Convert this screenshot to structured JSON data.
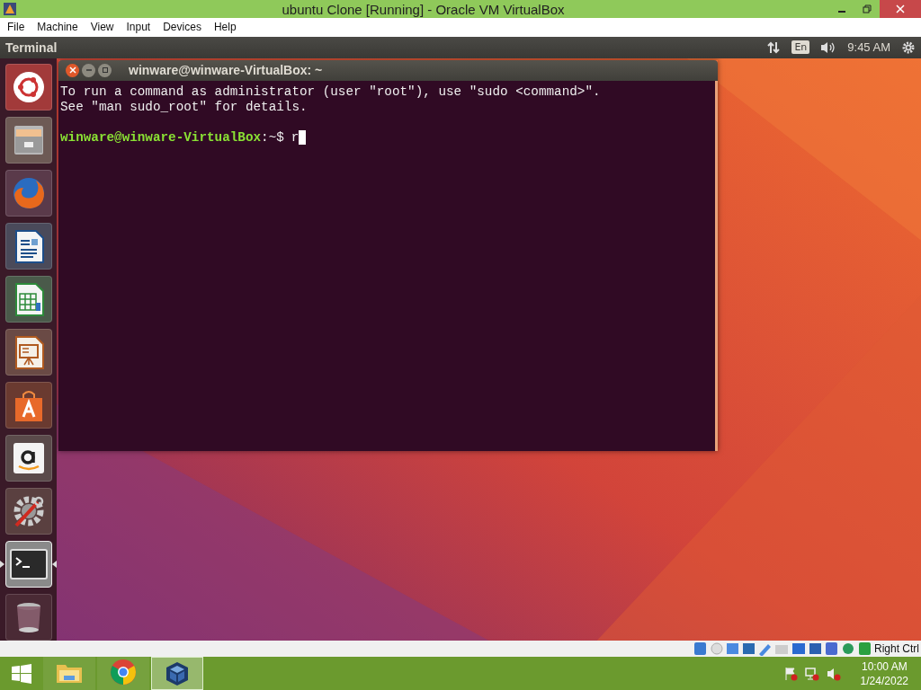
{
  "window": {
    "title": "ubuntu Clone [Running] - Oracle VM VirtualBox"
  },
  "menu": [
    "File",
    "Machine",
    "View",
    "Input",
    "Devices",
    "Help"
  ],
  "ubuntu_panel": {
    "app_title": "Terminal",
    "keyboard": "En",
    "clock": "9:45 AM"
  },
  "launcher": [
    {
      "kind": "ubuntu",
      "active": false
    },
    {
      "kind": "files",
      "active": false
    },
    {
      "kind": "firefox",
      "active": false
    },
    {
      "kind": "writer",
      "active": false
    },
    {
      "kind": "calc",
      "active": false
    },
    {
      "kind": "impress",
      "active": false
    },
    {
      "kind": "software",
      "active": false
    },
    {
      "kind": "amazon",
      "active": false
    },
    {
      "kind": "settings",
      "active": false
    },
    {
      "kind": "terminal",
      "active": true
    },
    {
      "kind": "trash",
      "active": false
    }
  ],
  "terminal": {
    "title": "winware@winware-VirtualBox: ~",
    "lines": [
      "To run a command as administrator (user \"root\"), use \"sudo <command>\".",
      "See \"man sudo_root\" for details."
    ],
    "prompt_user": "winware@winware-VirtualBox",
    "prompt_path": ":~$",
    "input": "r"
  },
  "vbox_status": {
    "host_key": "Right Ctrl"
  },
  "taskbar": {
    "items": [
      {
        "kind": "explorer",
        "selected": false
      },
      {
        "kind": "chrome",
        "selected": false
      },
      {
        "kind": "virtualbox",
        "selected": true
      }
    ],
    "time": "10:00 AM",
    "date": "1/24/2022"
  }
}
